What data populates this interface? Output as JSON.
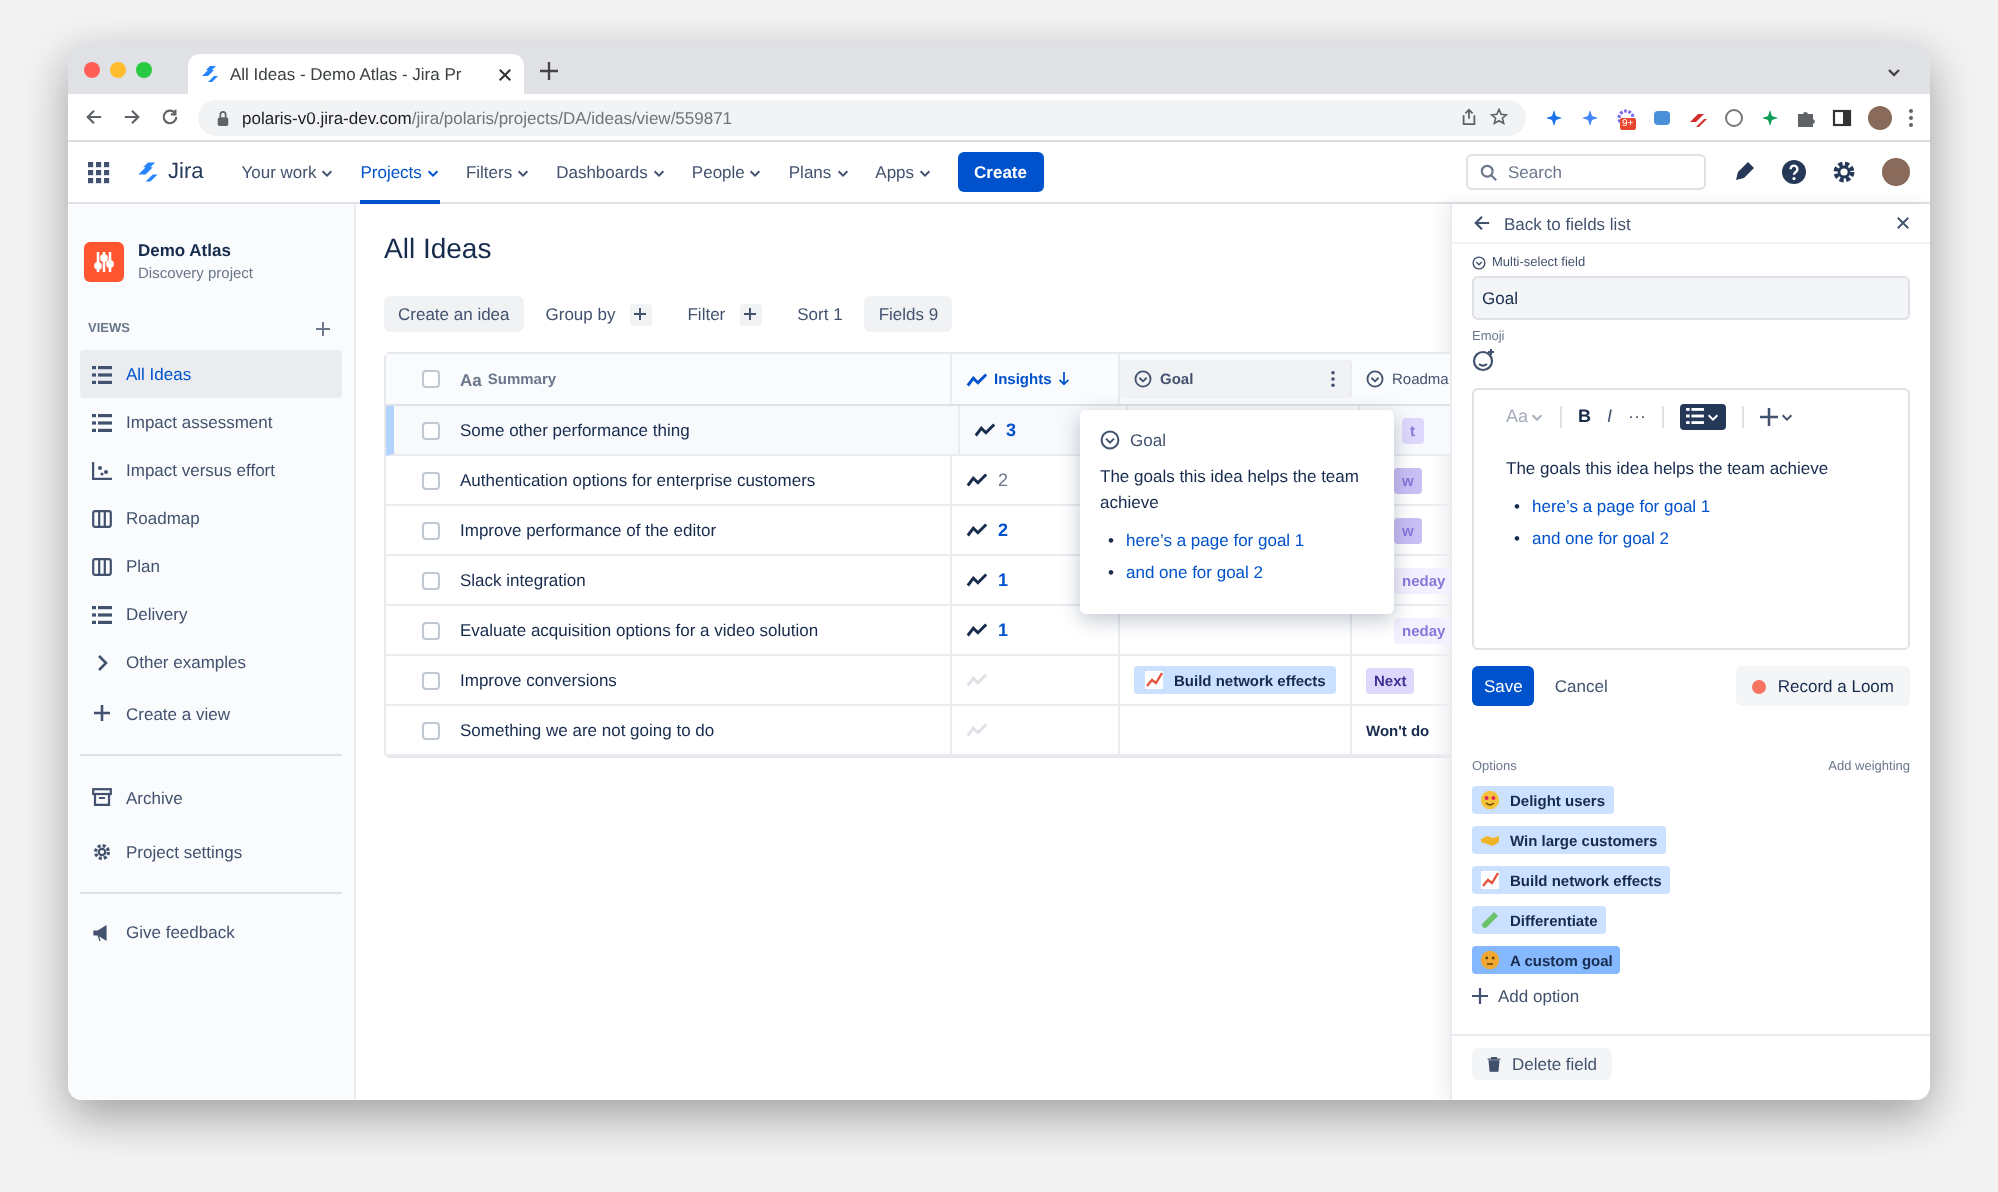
{
  "browser": {
    "tab_title": "All Ideas - Demo Atlas - Jira Pr",
    "url_host": "polaris-v0.jira-dev.com",
    "url_path": "/jira/polaris/projects/DA/ideas/view/559871",
    "extension_badge": "9+"
  },
  "nav": {
    "product": "Jira",
    "items": [
      {
        "label": "Your work",
        "selected": false
      },
      {
        "label": "Projects",
        "selected": true
      },
      {
        "label": "Filters",
        "selected": false
      },
      {
        "label": "Dashboards",
        "selected": false
      },
      {
        "label": "People",
        "selected": false
      },
      {
        "label": "Plans",
        "selected": false
      },
      {
        "label": "Apps",
        "selected": false
      }
    ],
    "create": "Create",
    "search": {
      "placeholder": "Search"
    }
  },
  "sidebar": {
    "project": {
      "name": "Demo Atlas",
      "type": "Discovery project"
    },
    "section": "VIEWS",
    "views": [
      {
        "label": "All Ideas",
        "kind": "list",
        "selected": true
      },
      {
        "label": "Impact assessment",
        "kind": "list",
        "selected": false
      },
      {
        "label": "Impact versus effort",
        "kind": "scatter",
        "selected": false
      },
      {
        "label": "Roadmap",
        "kind": "board",
        "selected": false
      },
      {
        "label": "Plan",
        "kind": "board",
        "selected": false
      },
      {
        "label": "Delivery",
        "kind": "list",
        "selected": false
      },
      {
        "label": "Other examples",
        "kind": "folder",
        "selected": false
      },
      {
        "label": "Create a view",
        "kind": "add",
        "selected": false
      }
    ],
    "footer": [
      {
        "label": "Archive",
        "kind": "archive"
      },
      {
        "label": "Project settings",
        "kind": "settings"
      }
    ],
    "feedback": "Give feedback"
  },
  "page": {
    "title": "All Ideas",
    "toolbar": [
      {
        "label": "Create an idea",
        "kind": "button"
      },
      {
        "label": "Group by",
        "kind": "add"
      },
      {
        "label": "Filter",
        "kind": "add"
      },
      {
        "label": "Sort",
        "kind": "count",
        "count": "1"
      },
      {
        "label": "Fields",
        "kind": "count_open",
        "count": "9"
      }
    ]
  },
  "table": {
    "select_all_checked": false,
    "columns": [
      {
        "label": "Summary",
        "kind": "summary",
        "sorted": false,
        "type_mark": "Aa"
      },
      {
        "label": "Insights",
        "kind": "insights",
        "sorted": true
      },
      {
        "label": "Goal",
        "kind": "goal",
        "sorted": false
      },
      {
        "label": "Roadma",
        "kind": "roadmap",
        "sorted": false
      }
    ],
    "rows": [
      {
        "summary": "Some other performance thing",
        "selected": true,
        "checked": false,
        "insights": "3",
        "insights_emphasized": true,
        "roadmap": {
          "label": "t",
          "kind": "partial",
          "color": "#dfd8fd"
        }
      },
      {
        "summary": "Authentication options for enterprise customers",
        "selected": false,
        "checked": false,
        "insights": "2",
        "insights_emphasized": false,
        "roadmap": {
          "label": "w",
          "kind": "partial",
          "color": "#c9bff5"
        }
      },
      {
        "summary": "Improve performance of the editor",
        "selected": false,
        "checked": false,
        "insights": "2",
        "insights_emphasized": true,
        "roadmap": {
          "label": "w",
          "kind": "partial",
          "color": "#c9bff5"
        }
      },
      {
        "summary": "Slack integration",
        "selected": false,
        "checked": false,
        "insights": "1",
        "insights_emphasized": true,
        "roadmap": {
          "label": "neday",
          "kind": "partial",
          "color": "#f3f0ff"
        }
      },
      {
        "summary": "Evaluate acquisition options for a video solution",
        "selected": false,
        "checked": false,
        "insights": "1",
        "insights_emphasized": true,
        "roadmap": {
          "label": "neday",
          "kind": "partial",
          "color": "#f3f0ff"
        }
      },
      {
        "summary": "Improve conversions",
        "selected": false,
        "checked": false,
        "goal": "Build network effects",
        "roadmap": {
          "label": "Next",
          "kind": "tag",
          "color": "#dfd8fd"
        }
      },
      {
        "summary": "Something we are not going to do",
        "selected": false,
        "checked": false,
        "roadmap": {
          "label": "Won't do",
          "kind": "plain",
          "color": "#ffffff"
        }
      }
    ]
  },
  "popup": {
    "bullet": "•",
    "field": "Goal",
    "description": "The goals this idea helps the team achieve",
    "links": [
      "here’s a page for goal 1",
      "and one for goal 2"
    ]
  },
  "panel": {
    "back": "Back to fields list",
    "field_type": "Multi-select field",
    "name_value": "Goal",
    "emoji_label": "Emoji",
    "editor": {
      "bullet": "•",
      "style_menu": "Aa",
      "bold": "B",
      "italic": "I",
      "more": "···",
      "list_active": true,
      "text": "The goals this idea helps the team achieve",
      "links": [
        "here’s a page for goal 1",
        "and one for goal 2"
      ]
    },
    "save": "Save",
    "cancel": "Cancel",
    "record": "Record a Loom",
    "options_label": "Options",
    "add_weighting": "Add weighting",
    "options": [
      {
        "label": "Delight users",
        "selected": false
      },
      {
        "label": "Win large customers",
        "selected": false
      },
      {
        "label": "Build network effects",
        "selected": false
      },
      {
        "label": "Differentiate",
        "selected": false
      },
      {
        "label": "A custom goal",
        "selected": true
      }
    ],
    "add_option": "Add option",
    "delete": "Delete field"
  }
}
